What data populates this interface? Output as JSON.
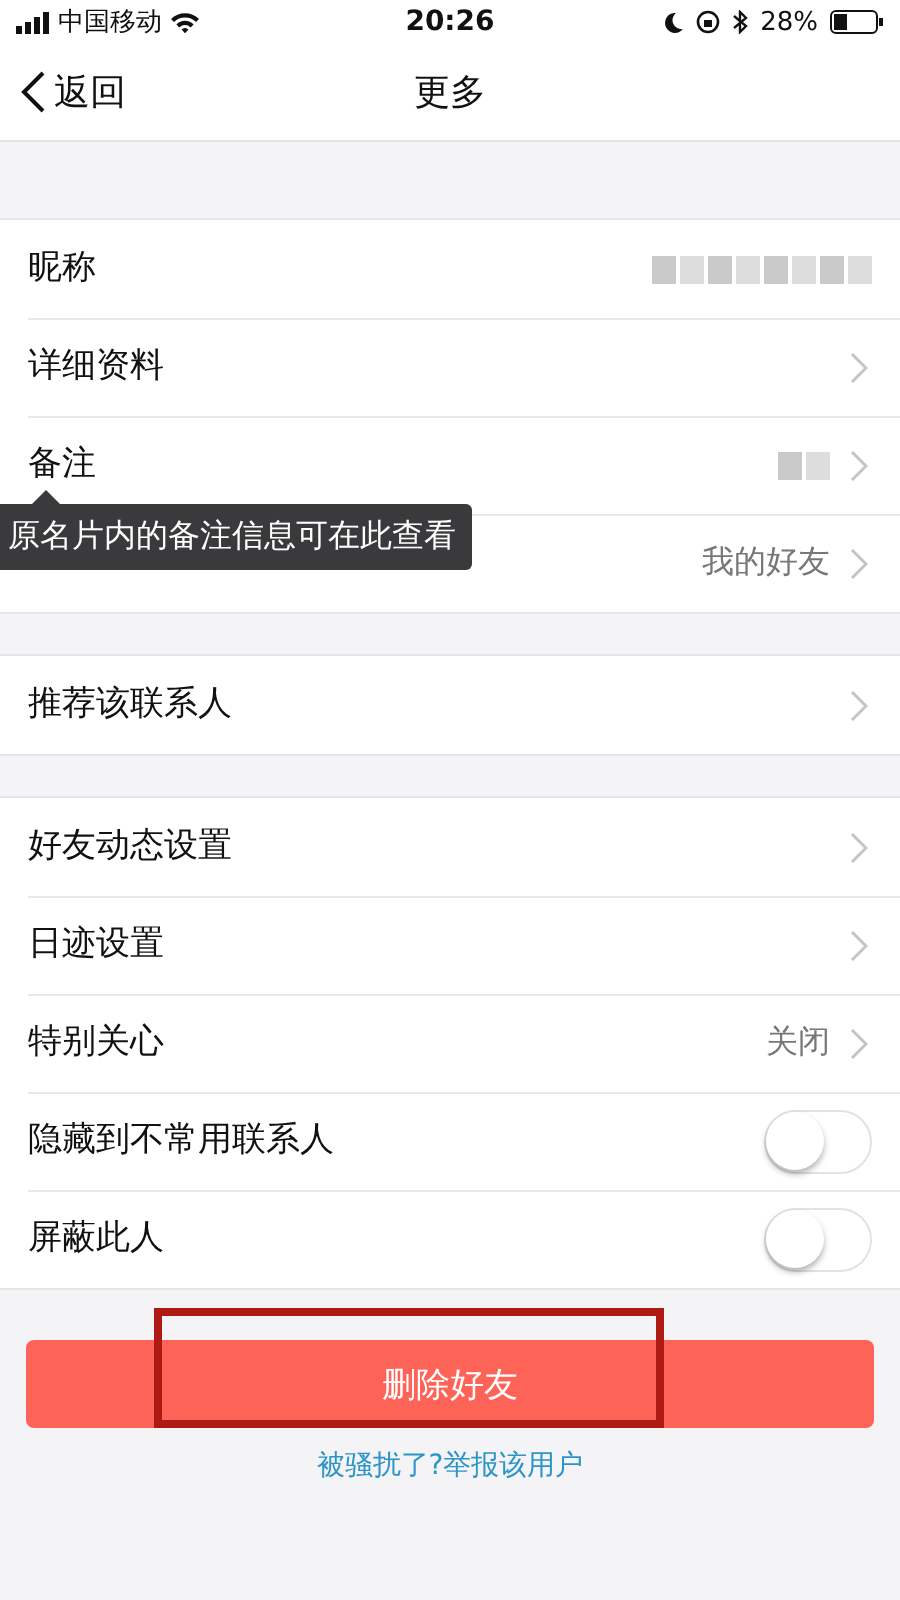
{
  "status_bar": {
    "carrier": "中国移动",
    "time": "20:26",
    "battery": "28%"
  },
  "nav": {
    "back": "返回",
    "title": "更多"
  },
  "groups": [
    {
      "rows": [
        {
          "kind": "value",
          "label": "昵称",
          "blurred": true
        },
        {
          "kind": "link",
          "label": "详细资料",
          "chevron": true
        },
        {
          "kind": "value",
          "label": "备注",
          "blurred": true,
          "chevron": true,
          "tooltip": "原名片内的备注信息可在此查看"
        },
        {
          "kind": "value",
          "value": "我的好友",
          "chevron": true
        }
      ]
    },
    {
      "rows": [
        {
          "kind": "link",
          "label": "推荐该联系人",
          "chevron": true
        }
      ]
    },
    {
      "rows": [
        {
          "kind": "link",
          "label": "好友动态设置",
          "chevron": true
        },
        {
          "kind": "link",
          "label": "日迹设置",
          "chevron": true
        },
        {
          "kind": "value",
          "label": "特别关心",
          "value": "关闭",
          "chevron": true
        },
        {
          "kind": "toggle",
          "label": "隐藏到不常用联系人",
          "on": false
        },
        {
          "kind": "toggle",
          "label": "屏蔽此人",
          "on": false
        }
      ]
    }
  ],
  "delete_button": {
    "label": "删除好友",
    "highlighted": true
  },
  "report_link": "被骚扰了?举报该用户"
}
